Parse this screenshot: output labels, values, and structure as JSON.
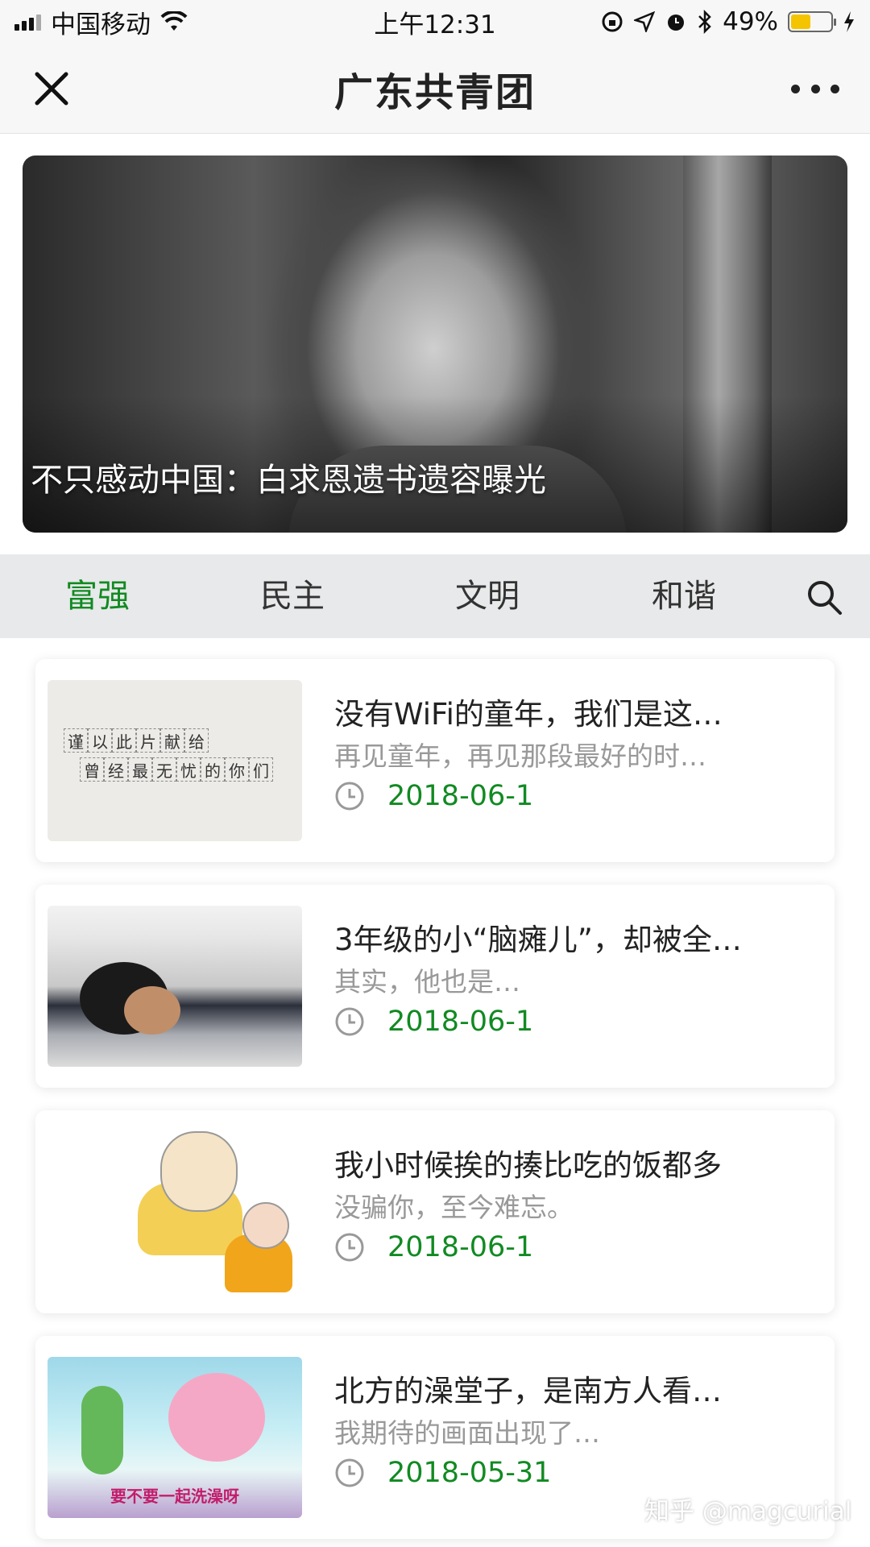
{
  "status_bar": {
    "carrier": "中国移动",
    "time": "上午12:31",
    "battery_percent": "49%",
    "battery_level": 0.49
  },
  "nav": {
    "title": "广东共青团"
  },
  "hero": {
    "caption": "不只感动中国：白求恩遗书遗容曝光"
  },
  "tabs": [
    {
      "label": "富强",
      "active": true
    },
    {
      "label": "民主",
      "active": false
    },
    {
      "label": "文明",
      "active": false
    },
    {
      "label": "和谐",
      "active": false
    }
  ],
  "articles": [
    {
      "title": "没有WiFi的童年，我们是这…",
      "subtitle": "再见童年，再见那段最好的时…",
      "date": "2018-06-1",
      "thumb_text": {
        "line1": [
          "谨",
          "以",
          "此",
          "片",
          "献",
          "给"
        ],
        "line2": [
          "曾",
          "经",
          "最",
          "无",
          "忧",
          "的",
          "你",
          "们"
        ]
      }
    },
    {
      "title": "3年级的小“脑瘫儿”，却被全…",
      "subtitle": "其实，他也是…",
      "date": "2018-06-1"
    },
    {
      "title": "我小时候挨的揍比吃的饭都多",
      "subtitle": "没骗你，至今难忘。",
      "date": "2018-06-1"
    },
    {
      "title": "北方的澡堂子，是南方人看…",
      "subtitle": "我期待的画面出现了…",
      "date": "2018-05-31",
      "thumb_caption": "要不要一起洗澡呀"
    }
  ],
  "watermark": "知乎 @magcurial",
  "colors": {
    "accent_green": "#118a22",
    "tab_bar_bg": "#e8e9ea",
    "battery_yellow": "#f5c400"
  }
}
